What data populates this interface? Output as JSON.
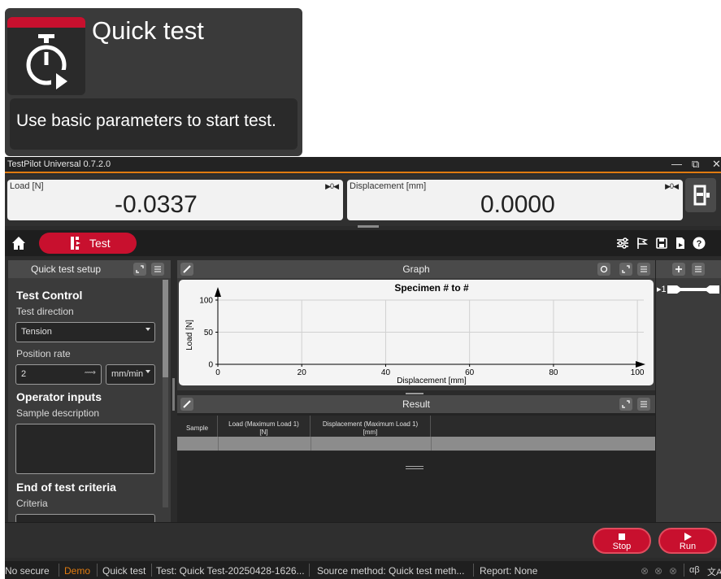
{
  "tooltip": {
    "title": "Quick test",
    "description": "Use basic parameters to start test.",
    "icon": "stopwatch-icon",
    "accent": "#c8102e"
  },
  "app": {
    "title": "TestPilot Universal 0.7.2.0",
    "window_controls": [
      "minimize",
      "restore",
      "close"
    ]
  },
  "readouts": [
    {
      "label": "Load [N]",
      "value": "-0.0337"
    },
    {
      "label": "Displacement [mm]",
      "value": "0.0000"
    }
  ],
  "tabs": {
    "active_label": "Test"
  },
  "left_panel": {
    "title": "Quick test setup",
    "section_test_control": "Test Control",
    "test_direction_label": "Test direction",
    "test_direction_value": "Tension",
    "position_rate_label": "Position rate",
    "position_rate_value": "2",
    "position_rate_unit": "mm/min",
    "section_operator": "Operator inputs",
    "sample_description_label": "Sample description",
    "section_end": "End of test criteria",
    "criteria_label": "Criteria"
  },
  "graph_panel": {
    "title": "Graph",
    "chart_title": "Specimen # to #",
    "xlabel": "Displacement [mm]",
    "ylabel": "Load [N]",
    "x_ticks": [
      "0",
      "20",
      "40",
      "60",
      "80",
      "100"
    ],
    "y_ticks": [
      "0",
      "50",
      "100"
    ]
  },
  "result_panel": {
    "title": "Result",
    "columns": [
      "Sample",
      "Load (Maximum Load 1)\n[N]",
      "Displacement (Maximum Load 1)\n[mm]"
    ]
  },
  "right_panel": {
    "specimen_label": "1"
  },
  "actions": {
    "stop_label": "Stop",
    "run_label": "Run"
  },
  "status": {
    "security": "No secure",
    "mode": "Demo",
    "test_type": "Quick test",
    "test_name": "Test: Quick Test-20250428-1626...",
    "source_method": "Source method: Quick test meth...",
    "report": "Report: None",
    "mode_color": "#e07b10"
  },
  "chart_data": {
    "type": "line",
    "title": "Specimen # to #",
    "xlabel": "Displacement [mm]",
    "ylabel": "Load [N]",
    "xlim": [
      0,
      100
    ],
    "ylim": [
      0,
      100
    ],
    "grid": true,
    "series": []
  }
}
